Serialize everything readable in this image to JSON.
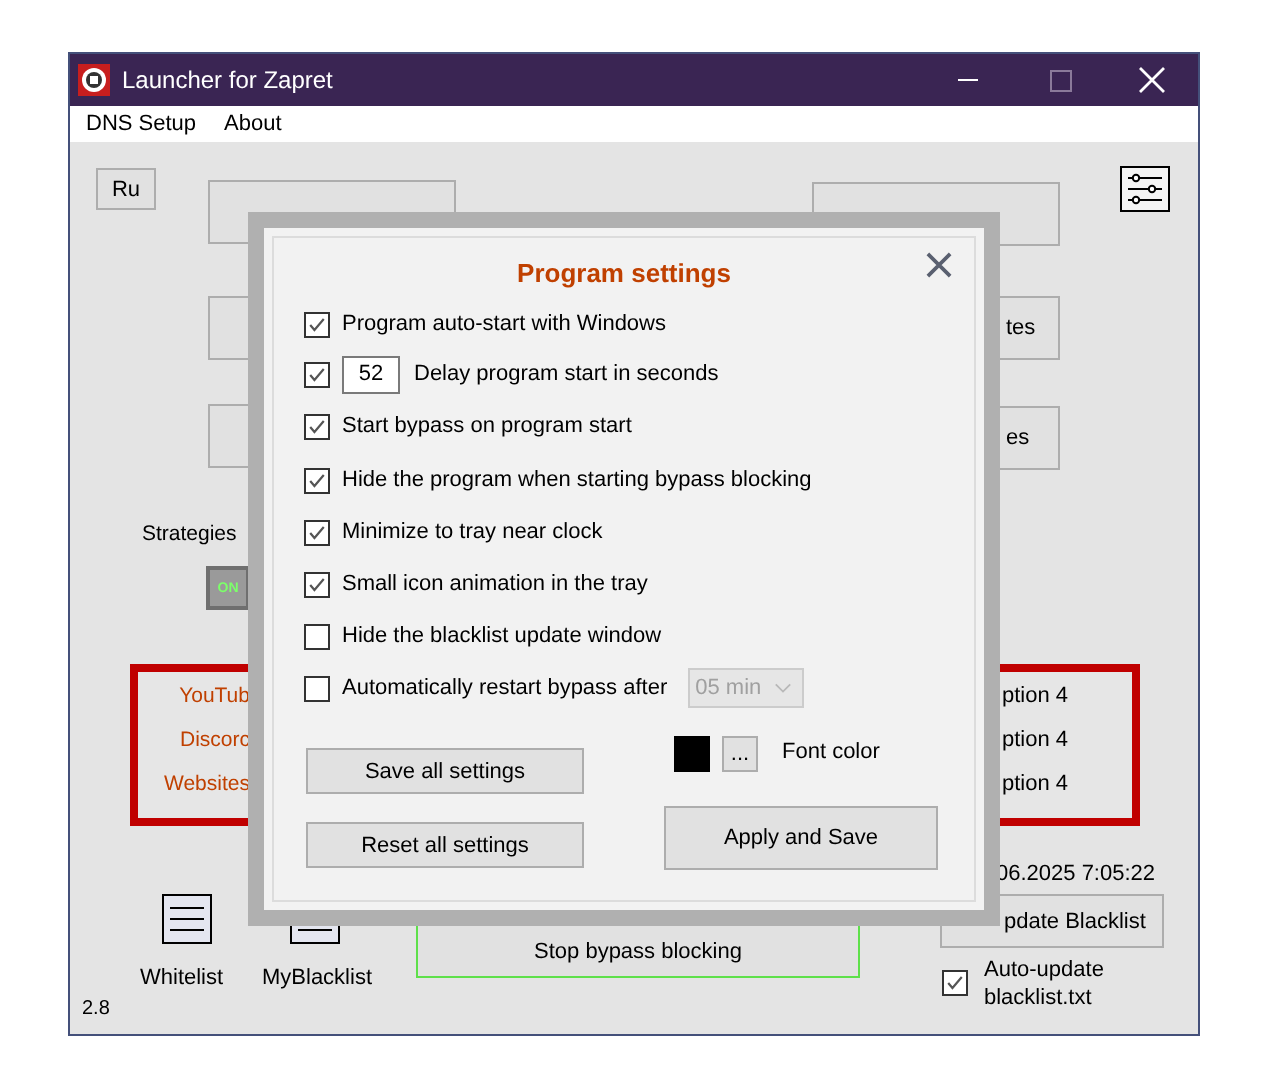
{
  "window": {
    "title": "Launcher for Zapret"
  },
  "menu": [
    "DNS Setup",
    "About"
  ],
  "language_button": "Ru",
  "right_buttons": [
    "tes",
    "es"
  ],
  "strategies_label": "Strategies",
  "toggle": {
    "label": "ON",
    "on": true
  },
  "services": [
    "YouTub",
    "Discorc",
    "Websites"
  ],
  "options": [
    "ption 4",
    "ption 4",
    "ption 4"
  ],
  "last_update": "06.2025 7:05:22",
  "update_button": "pdate Blacklist",
  "auto_update": {
    "label": "Auto-update blacklist.txt",
    "checked": true
  },
  "lists": [
    "Whitelist",
    "MyBlacklist"
  ],
  "stop_button": "Stop bypass blocking",
  "version": "2.8",
  "dialog": {
    "title": "Program settings",
    "options": [
      {
        "kind": "check",
        "label": "Program auto-start with Windows",
        "checked": true
      },
      {
        "kind": "number",
        "label": "Delay program start in seconds",
        "value": "52",
        "checked": true
      },
      {
        "kind": "check",
        "label": "Start bypass on program start",
        "checked": true
      },
      {
        "kind": "check",
        "label": "Hide the program when starting bypass blocking",
        "checked": true
      },
      {
        "kind": "check",
        "label": "Minimize to tray near clock",
        "checked": true
      },
      {
        "kind": "check",
        "label": "Small icon animation in the tray",
        "checked": true
      },
      {
        "kind": "check",
        "label": "Hide the blacklist update window",
        "checked": false
      },
      {
        "kind": "select",
        "label": "Automatically restart bypass after",
        "value": "05 min",
        "checked": false
      }
    ],
    "save_button": "Save all settings",
    "reset_button": "Reset all settings",
    "font_color": {
      "label": "Font color",
      "color": "#000000",
      "button": "..."
    },
    "apply_button": "Apply and Save"
  }
}
